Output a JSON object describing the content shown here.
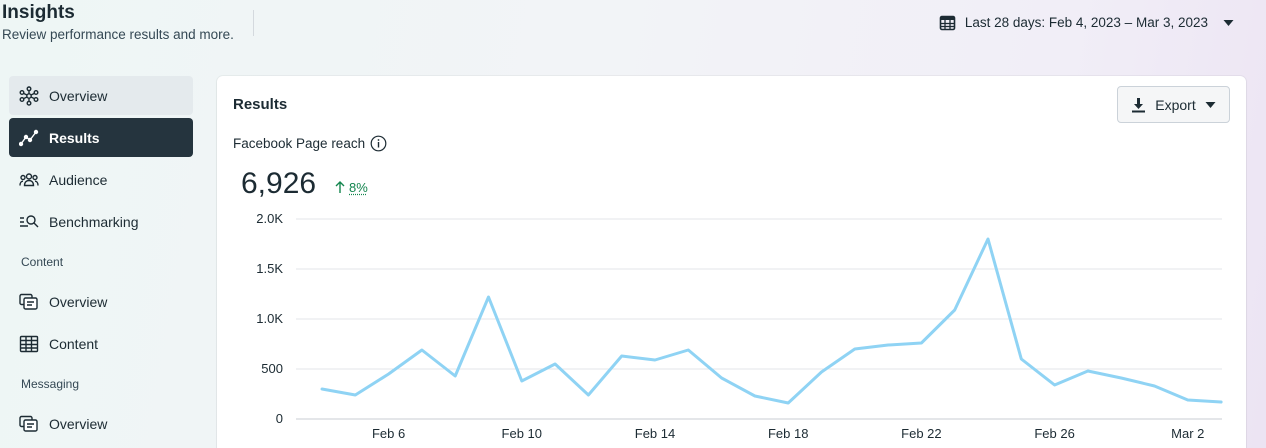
{
  "header": {
    "title": "Insights",
    "subtitle": "Review performance results and more.",
    "date_range": "Last 28 days: Feb 4, 2023 – Mar 3, 2023"
  },
  "sidebar": {
    "items": [
      {
        "label": "Overview",
        "icon": "network-icon",
        "state": "hover"
      },
      {
        "label": "Results",
        "icon": "trend-icon",
        "state": "active"
      },
      {
        "label": "Audience",
        "icon": "people-icon",
        "state": "normal"
      },
      {
        "label": "Benchmarking",
        "icon": "benchmark-search-icon",
        "state": "normal"
      }
    ],
    "sections": [
      {
        "label": "Content",
        "items": [
          {
            "label": "Overview",
            "icon": "cards-icon"
          },
          {
            "label": "Content",
            "icon": "table-icon"
          }
        ]
      },
      {
        "label": "Messaging",
        "items": [
          {
            "label": "Overview",
            "icon": "cards-icon"
          }
        ]
      }
    ]
  },
  "card": {
    "title": "Results",
    "export_label": "Export",
    "metric_label": "Facebook Page reach",
    "metric_value": "6,926",
    "metric_change": "8%"
  },
  "colors": {
    "line": "#8fd3f4",
    "active_nav": "#25343e",
    "positive": "#13854e"
  },
  "chart_data": {
    "type": "line",
    "y_ticks": [
      "0",
      "500",
      "1.0K",
      "1.5K",
      "2.0K"
    ],
    "y_tick_values": [
      0,
      500,
      1000,
      1500,
      2000
    ],
    "ylim": [
      0,
      2000
    ],
    "x_tick_labels": [
      "Feb 6",
      "Feb 10",
      "Feb 14",
      "Feb 18",
      "Feb 22",
      "Feb 26",
      "Mar 2"
    ],
    "x_tick_index": [
      2,
      6,
      10,
      14,
      18,
      22,
      26
    ],
    "x": [
      "Feb 4",
      "Feb 5",
      "Feb 6",
      "Feb 7",
      "Feb 8",
      "Feb 9",
      "Feb 10",
      "Feb 11",
      "Feb 12",
      "Feb 13",
      "Feb 14",
      "Feb 15",
      "Feb 16",
      "Feb 17",
      "Feb 18",
      "Feb 19",
      "Feb 20",
      "Feb 21",
      "Feb 22",
      "Feb 23",
      "Feb 24",
      "Feb 25",
      "Feb 26",
      "Feb 27",
      "Feb 28",
      "Mar 1",
      "Mar 2",
      "Mar 3"
    ],
    "values": [
      300,
      240,
      450,
      690,
      430,
      1220,
      380,
      550,
      240,
      630,
      590,
      690,
      410,
      230,
      160,
      470,
      700,
      740,
      760,
      1090,
      1800,
      600,
      340,
      480,
      410,
      330,
      190,
      170
    ],
    "grid": true
  }
}
